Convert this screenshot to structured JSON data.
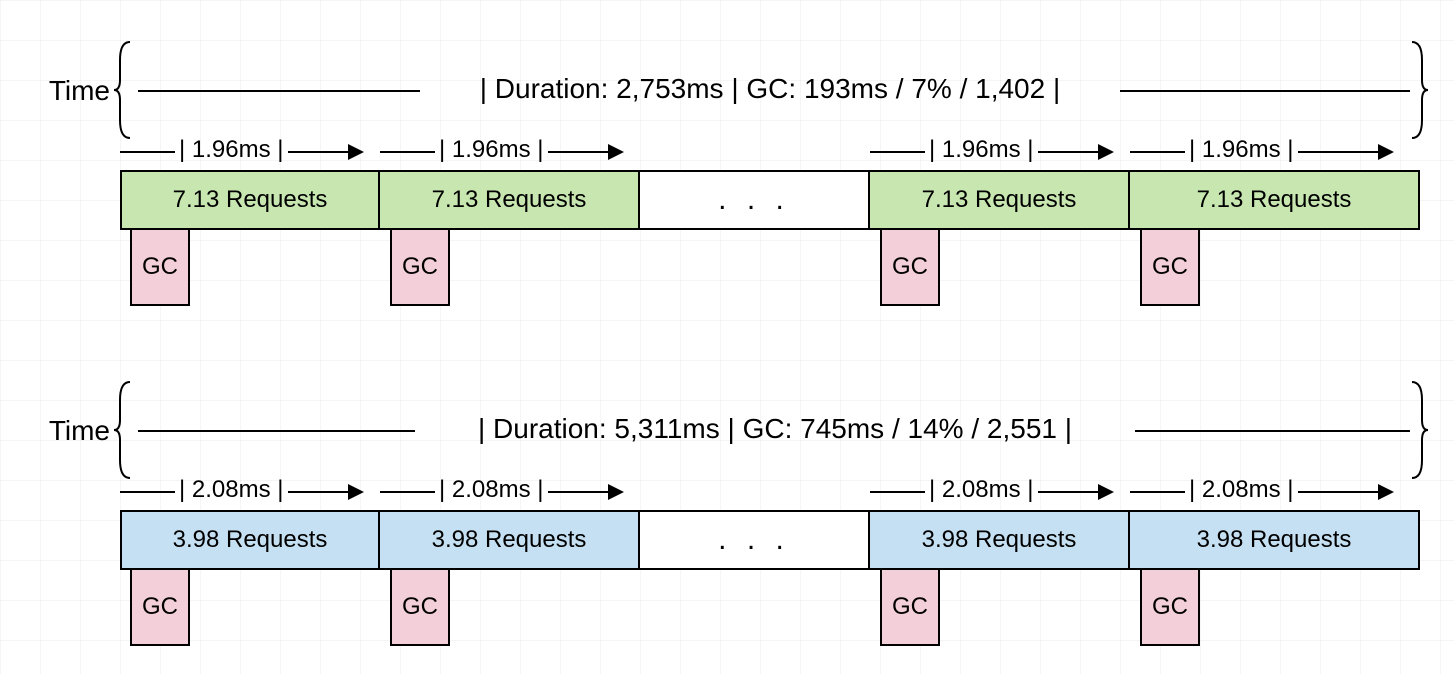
{
  "timelines": [
    {
      "time_label": "Time",
      "duration_label": "| Duration: 2,753ms | GC: 193ms / 7% / 1,402 |",
      "segment_time": "| 1.96ms |",
      "block_label": "7.13 Requests",
      "gc_label": "GC",
      "ellipsis": ". . .",
      "block_color": "green"
    },
    {
      "time_label": "Time",
      "duration_label": "| Duration: 5,311ms | GC: 745ms / 14% / 2,551 |",
      "segment_time": "| 2.08ms |",
      "block_label": "3.98 Requests",
      "gc_label": "GC",
      "ellipsis": ". . .",
      "block_color": "blue"
    }
  ]
}
